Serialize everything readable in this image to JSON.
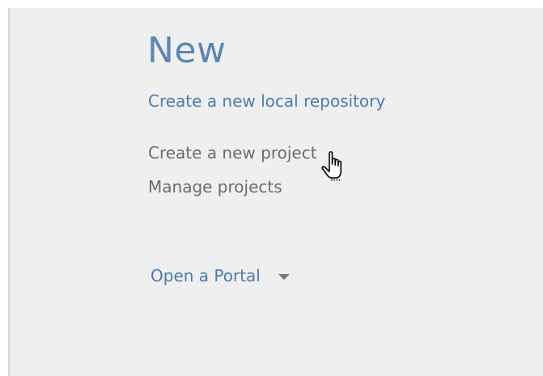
{
  "panel": {
    "title": "New",
    "links": {
      "create_repository": "Create a new local repository",
      "create_project": "Create a new project",
      "manage_projects": "Manage projects"
    },
    "portal": {
      "label": "Open a Portal",
      "icon": "chevron-down-icon"
    }
  },
  "cursor": {
    "icon": "hand-pointer-icon"
  },
  "colors": {
    "title": "#5b86b6",
    "link_blue": "#4a7cb0",
    "link_gray": "#6b6b6b",
    "panel_bg": "#efefef",
    "panel_border": "#d9d9d9"
  }
}
